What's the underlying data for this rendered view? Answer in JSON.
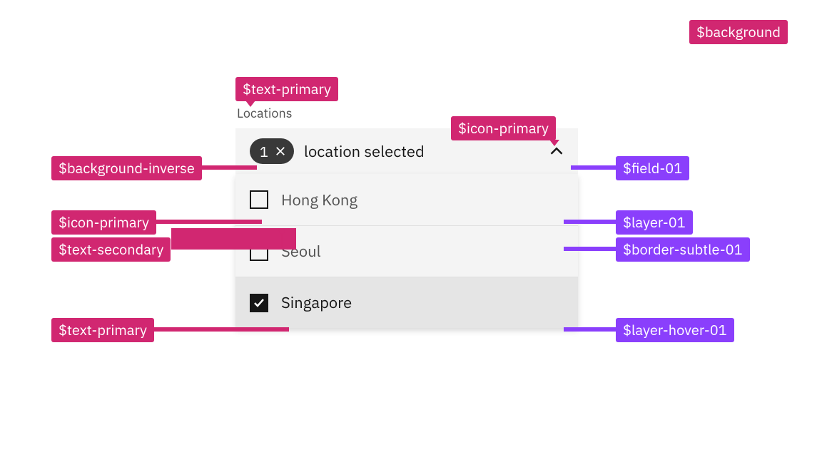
{
  "colors": {
    "pink": "#d12771",
    "purple": "#8a3ffc",
    "field": "#f4f4f4",
    "layer": "#f4f4f4",
    "layer_hover": "#e5e5e5",
    "border_subtle": "#e0e0e0",
    "text_primary": "#161616",
    "text_secondary": "#525252",
    "background_inverse": "#393939",
    "background": "#ffffff"
  },
  "multiselect": {
    "label": "Locations",
    "selected_count": "1",
    "summary_text": "location selected",
    "options": [
      {
        "label": "Hong Kong",
        "checked": false,
        "hovered": false
      },
      {
        "label": "Seoul",
        "checked": false,
        "hovered": false
      },
      {
        "label": "Singapore",
        "checked": true,
        "hovered": true
      }
    ]
  },
  "annotations": {
    "background": "$background",
    "text_primary_top": "$text-primary",
    "icon_primary_top": "$icon-primary",
    "background_inverse": "$background-inverse",
    "field_01": "$field-01",
    "icon_primary_left": "$icon-primary",
    "layer_01": "$layer-01",
    "text_secondary": "$text-secondary",
    "border_subtle_01": "$border-subtle-01",
    "text_primary_left": "$text-primary",
    "layer_hover_01": "$layer-hover-01"
  }
}
